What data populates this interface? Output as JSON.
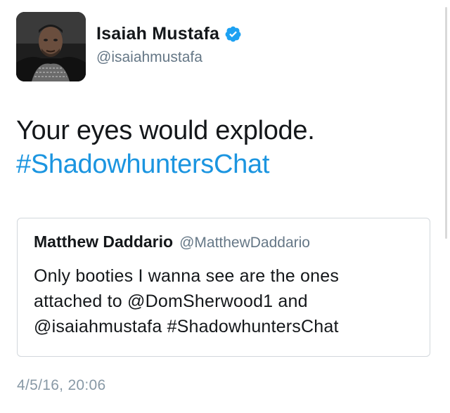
{
  "tweet": {
    "author": {
      "display_name": "Isaiah Mustafa",
      "handle": "@isaiahmustafa",
      "verified": true,
      "avatar_icon": "profile-photo"
    },
    "text_line1": "Your eyes would explode.",
    "hashtag": "#ShadowhuntersChat",
    "timestamp": "4/5/16, 20:06"
  },
  "quoted_tweet": {
    "display_name": "Matthew Daddario",
    "handle": "@MatthewDaddario",
    "text_line1": "Only booties I wanna see are the ones",
    "text_line2": "attached to @DomSherwood1 and",
    "text_line3": "@isaiahmustafa #ShadowhuntersChat"
  },
  "colors": {
    "hashtag": "#1b95e0",
    "verified_badge": "#1da1f2",
    "secondary_text": "#657786",
    "timestamp": "#8899a6",
    "border": "#d2d7dc"
  }
}
